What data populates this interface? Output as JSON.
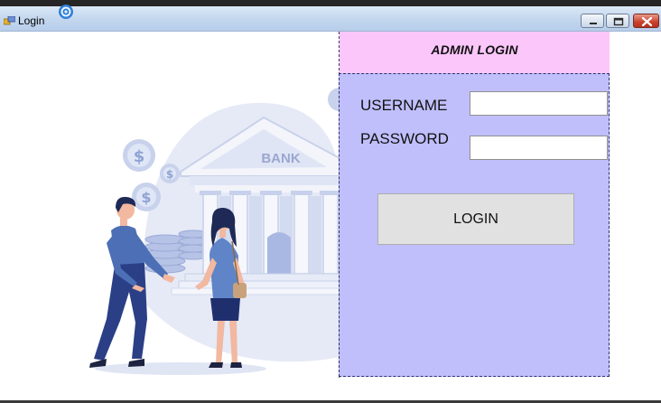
{
  "window": {
    "title": "Login",
    "icons": {
      "app": "app-icon",
      "minimize": "minimize-icon",
      "maximize": "maximize-icon",
      "close": "close-icon"
    }
  },
  "illustration": {
    "bank_sign": "BANK",
    "icons": [
      "dollar-coin-icon",
      "bank-building-icon",
      "man-figure-icon",
      "woman-figure-icon"
    ]
  },
  "login_form": {
    "header": "ADMIN LOGIN",
    "username_label": "USERNAME",
    "username_value": "",
    "password_label": "PASSWORD",
    "password_value": "",
    "login_button": "LOGIN"
  },
  "colors": {
    "header_bg": "#fbc6fa",
    "form_bg": "#c0bffc",
    "button_bg": "#e1e1e1",
    "illustration_accent": "#4c6fb5"
  }
}
